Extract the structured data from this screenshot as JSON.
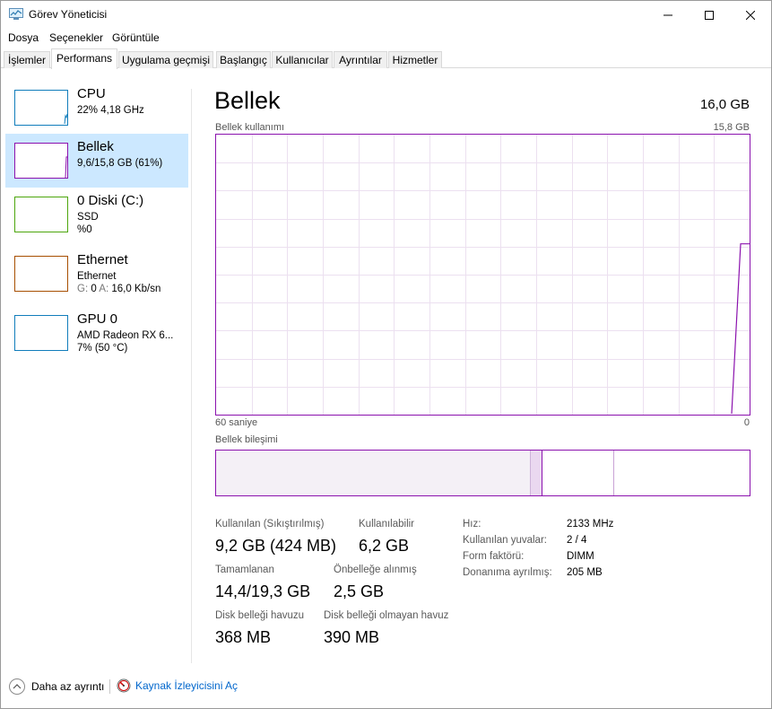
{
  "window": {
    "title": "Görev Yöneticisi"
  },
  "menu": [
    "Dosya",
    "Seçenekler",
    "Görüntüle"
  ],
  "tabs": [
    "İşlemler",
    "Performans",
    "Uygulama geçmişi",
    "Başlangıç",
    "Kullanıcılar",
    "Ayrıntılar",
    "Hizmetler"
  ],
  "active_tab": "Performans",
  "sidebar": [
    {
      "title": "CPU",
      "line1": "22%  4,18 GHz",
      "line2": "",
      "color": "#117dbb"
    },
    {
      "title": "Bellek",
      "line1": "9,6/15,8 GB (61%)",
      "line2": "",
      "color": "#8b12ae",
      "selected": true,
      "fill_fraction": 0.61
    },
    {
      "title": "0 Diski (C:)",
      "line1": "SSD",
      "line2": "%0",
      "color": "#4da60c"
    },
    {
      "title": "Ethernet",
      "line1": "Ethernet",
      "line2_g_label": "G:",
      "line2_g_value": "0",
      "line2_a_label": "A:",
      "line2_a_value": "16,0 Kb/sn",
      "color": "#a74f01"
    },
    {
      "title": "GPU 0",
      "line1": "AMD Radeon RX 6...",
      "line2": "7%  (50 °C)",
      "color": "#117dbb"
    }
  ],
  "main": {
    "title": "Bellek",
    "total": "16,0 GB",
    "usage_label": "Bellek kullanımı",
    "usage_max": "15,8 GB",
    "axis_left": "60 saniye",
    "axis_right": "0",
    "composition_label": "Bellek bileşimi",
    "graph_color": "#8b12ae",
    "usage_current_fraction": 0.61
  },
  "stats": {
    "in_use_label": "Kullanılan (Sıkıştırılmış)",
    "in_use_value": "9,2 GB (424 MB)",
    "available_label": "Kullanılabilir",
    "available_value": "6,2 GB",
    "committed_label": "Tamamlanan",
    "committed_value": "14,4/19,3 GB",
    "cached_label": "Önbelleğe alınmış",
    "cached_value": "2,5 GB",
    "paged_label": "Disk belleği havuzu",
    "paged_value": "368 MB",
    "nonpaged_label": "Disk belleği olmayan havuz",
    "nonpaged_value": "390 MB"
  },
  "details": [
    {
      "key": "Hız:",
      "value": "2133 MHz"
    },
    {
      "key": "Kullanılan yuvalar:",
      "value": "2 / 4"
    },
    {
      "key": "Form faktörü:",
      "value": "DIMM"
    },
    {
      "key": "Donanıma ayrılmış:",
      "value": "205 MB"
    }
  ],
  "footer": {
    "fewer_details": "Daha az ayrıntı",
    "resource_monitor": "Kaynak İzleyicisini Aç"
  }
}
